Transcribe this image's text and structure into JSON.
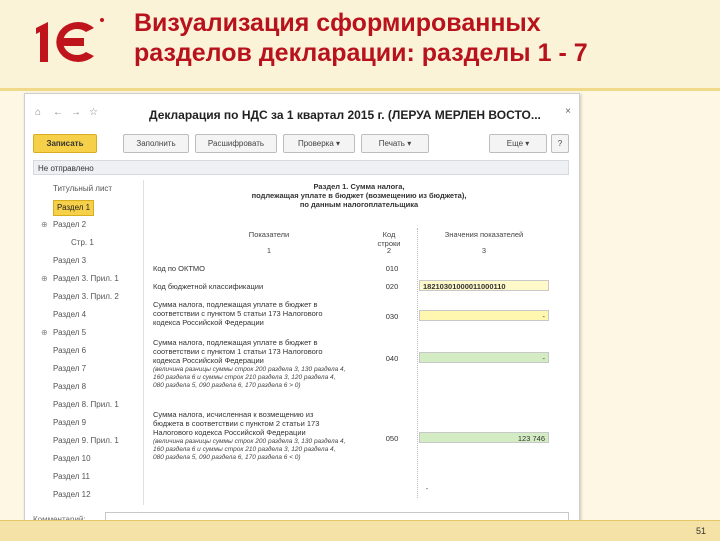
{
  "slide": {
    "title_line1": "Визуализация сформированных",
    "title_line2": "разделов декларации: разделы 1 - 7",
    "page_number": "51",
    "logo_text": "1С"
  },
  "window": {
    "title": "Декларация по НДС за 1 квартал 2015 г. (ЛЕРУА МЕРЛЕН ВОСТО...",
    "close": "×"
  },
  "toolbar": {
    "save_label": "Записать",
    "fill_label": "Заполнить",
    "expand_label": "Расшифровать",
    "check_label": "Проверка",
    "print_label": "Печать",
    "more_label": "Еще",
    "help_label": "?"
  },
  "status": "Не отправлено",
  "nav": [
    {
      "label": "Титульный лист",
      "expander": "",
      "indent": 0,
      "selected": false
    },
    {
      "label": "Раздел 1",
      "expander": "",
      "indent": 0,
      "selected": true
    },
    {
      "label": "Раздел 2",
      "expander": "⊕",
      "indent": 0,
      "selected": false
    },
    {
      "label": "Стр. 1",
      "expander": "",
      "indent": 1,
      "selected": false
    },
    {
      "label": "Раздел 3",
      "expander": "",
      "indent": 0,
      "selected": false
    },
    {
      "label": "Раздел 3. Прил. 1",
      "expander": "⊕",
      "indent": 0,
      "selected": false
    },
    {
      "label": "Раздел 3. Прил. 2",
      "expander": "",
      "indent": 0,
      "selected": false
    },
    {
      "label": "Раздел 4",
      "expander": "",
      "indent": 0,
      "selected": false
    },
    {
      "label": "Раздел 5",
      "expander": "⊕",
      "indent": 0,
      "selected": false
    },
    {
      "label": "Раздел 6",
      "expander": "",
      "indent": 0,
      "selected": false
    },
    {
      "label": "Раздел 7",
      "expander": "",
      "indent": 0,
      "selected": false
    },
    {
      "label": "Раздел 8",
      "expander": "",
      "indent": 0,
      "selected": false
    },
    {
      "label": "Раздел 8. Прил. 1",
      "expander": "",
      "indent": 0,
      "selected": false
    },
    {
      "label": "Раздел 9",
      "expander": "",
      "indent": 0,
      "selected": false
    },
    {
      "label": "Раздел 9. Прил. 1",
      "expander": "",
      "indent": 0,
      "selected": false
    },
    {
      "label": "Раздел 10",
      "expander": "",
      "indent": 0,
      "selected": false
    },
    {
      "label": "Раздел 11",
      "expander": "",
      "indent": 0,
      "selected": false
    },
    {
      "label": "Раздел 12",
      "expander": "",
      "indent": 0,
      "selected": false
    }
  ],
  "section": {
    "title_l1": "Раздел 1. Сумма налога,",
    "title_l2": "подлежащая уплате в бюджет (возмещению из бюджета),",
    "title_l3": "по данным налогоплательщика",
    "col_indicator": "Показатели",
    "col_code_l1": "Код",
    "col_code_l2": "строки",
    "col_values": "Значения показателей",
    "num_1": "1",
    "num_2": "2",
    "num_3": "3"
  },
  "fields": {
    "oktmo_label": "Код по ОКТМО",
    "oktmo_code": "010",
    "kbk_label": "Код бюджетной классификации",
    "kbk_code": "020",
    "kbk_value": "18210301000011000110",
    "f030_l1": "Сумма налога, подлежащая уплате в бюджет в",
    "f030_l2": "соответствии с пунктом 5 статьи 173 Налогового",
    "f030_l3": "кодекса Российской Федерации",
    "f030_code": "030",
    "f030_value": "-",
    "f040_l1": "Сумма налога, подлежащая уплате в бюджет в",
    "f040_l2": "соответствии с пунктом 1 статьи 173 Налогового",
    "f040_l3": "кодекса Российской Федерации",
    "f040_n1": "(величина разницы суммы строк 200 раздела 3, 130 раздела 4,",
    "f040_n2": "160 раздела 6 и суммы строк 210 раздела 3, 120 раздела 4,",
    "f040_n3": "080 раздела 5, 090 раздела 6, 170 раздела 6 > 0)",
    "f040_code": "040",
    "f040_value": "-",
    "f050_l1": "Сумма налога, исчисленная к возмещению из",
    "f050_l2": "бюджета в соответствии с пунктом 2 статьи 173",
    "f050_l3": "Налогового кодекса Российской Федерации",
    "f050_n1": "(величина разницы суммы строк 200 раздела 3, 130 раздела 4,",
    "f050_n2": "160 раздела 6 и суммы строк 210 раздела 3, 120 раздела 4,",
    "f050_n3": "080 раздела 5, 090 раздела 6, 170 раздела 6 < 0)",
    "f050_code": "050",
    "f050_value": "123 746",
    "tail_value": "-"
  },
  "comment_label": "Комментарий:"
}
